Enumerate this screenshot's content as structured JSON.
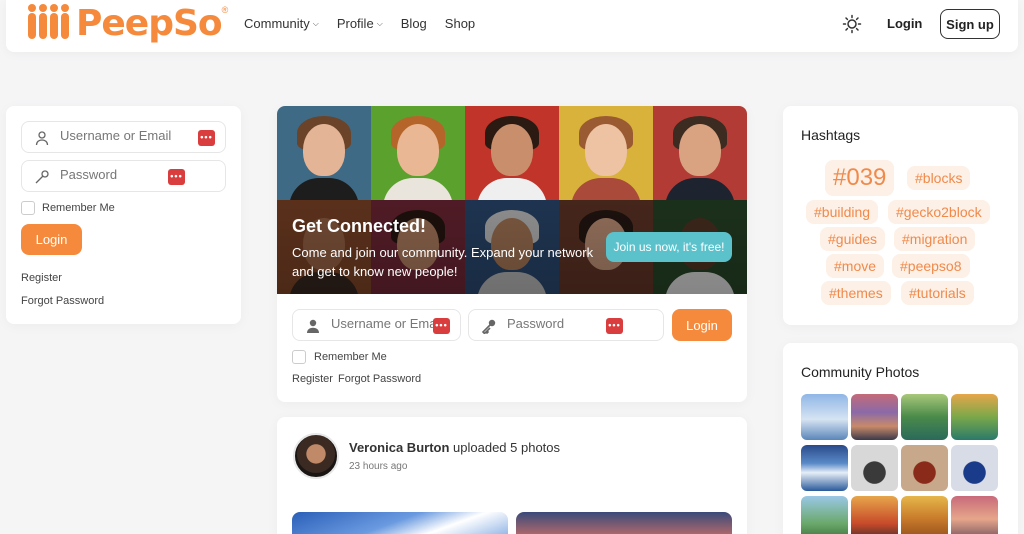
{
  "header": {
    "logo_text": "PeepSo",
    "logo_reg": "®",
    "nav": [
      {
        "label": "Community",
        "dropdown": true
      },
      {
        "label": "Profile",
        "dropdown": true
      },
      {
        "label": "Blog",
        "dropdown": false
      },
      {
        "label": "Shop",
        "dropdown": false
      }
    ],
    "theme_icon": "sun-icon",
    "login_label": "Login",
    "signup_label": "Sign up"
  },
  "left_login": {
    "username_placeholder": "Username or Email",
    "password_placeholder": "Password",
    "remember_label": "Remember Me",
    "login_button": "Login",
    "register_link": "Register",
    "forgot_link": "Forgot Password"
  },
  "hero": {
    "title": "Get Connected!",
    "text": "Come and join our community. Expand your network and get to know new people!",
    "join_button": "Join us now, it's free!",
    "username_placeholder": "Username or Email",
    "password_placeholder": "Password",
    "login_button": "Login",
    "remember_label": "Remember Me",
    "register_link": "Register",
    "forgot_link": "Forgot Password"
  },
  "post": {
    "author": "Veronica Burton",
    "action": " uploaded 5 photos",
    "time": "23 hours ago"
  },
  "hashtags": {
    "title": "Hashtags",
    "tags": [
      "#039",
      "#blocks",
      "#building",
      "#gecko2block",
      "#guides",
      "#migration",
      "#move",
      "#peepso8",
      "#themes",
      "#tutorials"
    ]
  },
  "photos": {
    "title": "Community Photos"
  },
  "colors": {
    "brand": "#f58a3c",
    "accent_teal": "#5bc2cc",
    "tag_bg": "#fdf0e6",
    "tag_text": "#f08a4b"
  }
}
